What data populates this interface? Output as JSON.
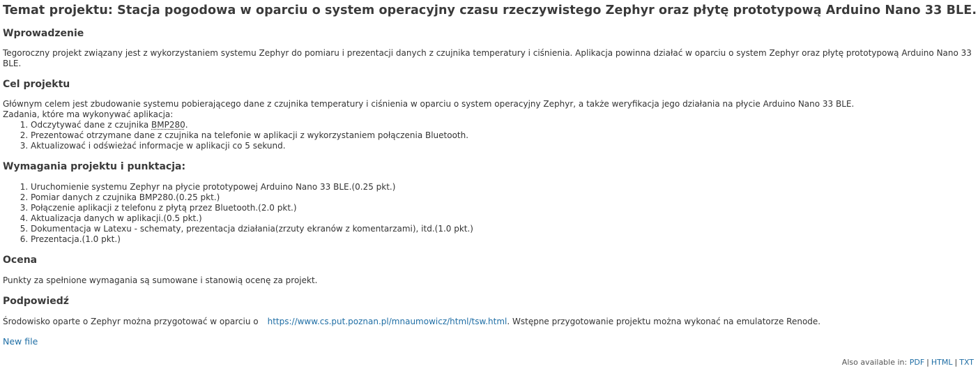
{
  "title": "Temat projektu: Stacja pogodowa w oparciu o system operacyjny czasu rzeczywistego Zephyr oraz płytę prototypową Arduino Nano 33 BLE.",
  "intro": {
    "heading": "Wprowadzenie",
    "text": "Tegoroczny projekt związany jest z wykorzystaniem systemu Zephyr do pomiaru i prezentacji danych z czujnika temperatury i ciśnienia. Aplikacja powinna działać w oparciu o system Zephyr oraz płytę prototypową Arduino Nano 33 BLE."
  },
  "goal": {
    "heading": "Cel projektu",
    "text": "Głównym celem jest zbudowanie systemu pobierającego dane z czujnika temperatury i ciśnienia w oparciu o system operacyjny Zephyr, a także weryfikacja jego działania na płycie Arduino Nano 33 BLE.",
    "tasks_intro": "Zadania, które ma wykonywać aplikacja:",
    "task1_pre": "Odczytywać dane z czujnika ",
    "task1_abbr": "BMP280",
    "task1_post": ".",
    "tasks": [
      "Prezentować otrzymane dane z czujnika na telefonie w aplikacji z wykorzystaniem połączenia Bluetooth.",
      "Aktualizować i odświeżać informacje w aplikacji co 5 sekund."
    ]
  },
  "requirements": {
    "heading": "Wymagania projektu i punktacja:",
    "items": [
      "Uruchomienie systemu Zephyr na płycie prototypowej Arduino Nano 33 BLE.(0.25 pkt.)",
      "Pomiar danych z czujnika BMP280.(0.25 pkt.)",
      "Połączenie aplikacji z telefonu z płytą przez Bluetooth.(2.0 pkt.)",
      "Aktualizacja danych w aplikacji.(0.5 pkt.)",
      "Dokumentacja w Latexu - schematy, prezentacja działania(zrzuty ekranów z komentarzami), itd.(1.0 pkt.)",
      "Prezentacja.(1.0 pkt.)"
    ]
  },
  "grading": {
    "heading": "Ocena",
    "text": "Punkty za spełnione wymagania są sumowane i stanowią ocenę za projekt."
  },
  "hint": {
    "heading": "Podpowiedź",
    "text_before": "Środowisko oparte o Zephyr można przygotować w oparciu o",
    "link": "https://www.cs.put.poznan.pl/mnaumowicz/html/tsw.html",
    "text_after": ". Wstępne przygotowanie projektu można wykonać na emulatorze Renode."
  },
  "new_file_link": "New file",
  "footer": {
    "label": "Also available in:",
    "formats": [
      "PDF",
      "HTML",
      "TXT"
    ],
    "separator": "|"
  },
  "colors": {
    "link": "#1f6ea5",
    "heading": "#3a3a3a",
    "text": "#333333"
  }
}
